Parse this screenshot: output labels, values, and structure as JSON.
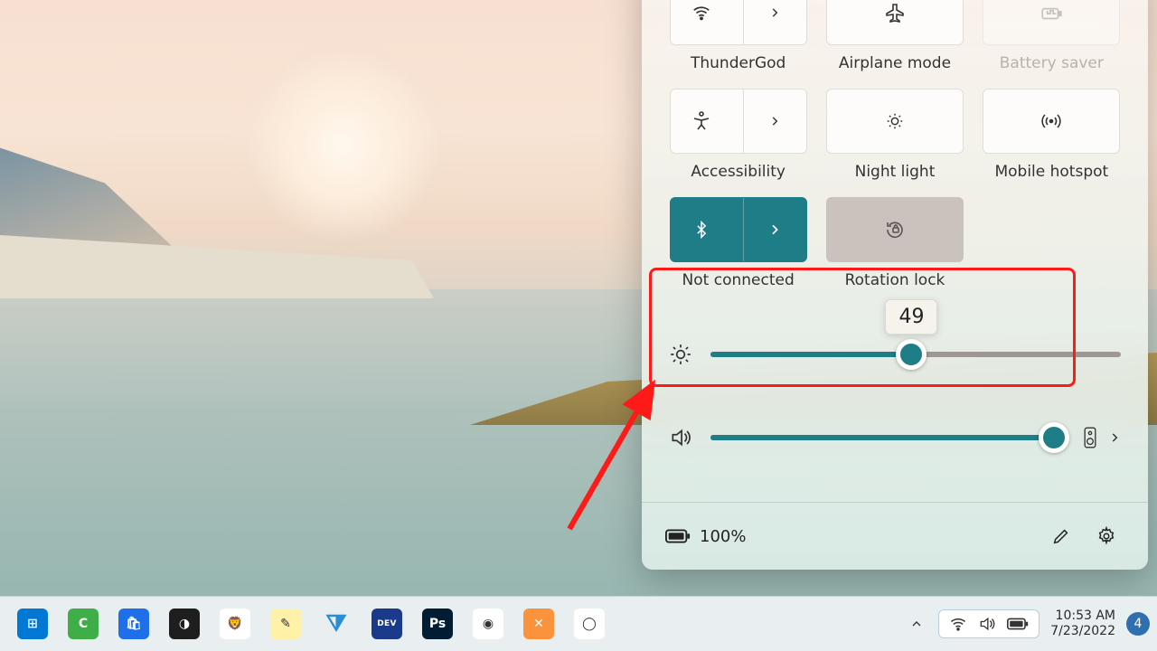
{
  "colors": {
    "accent": "#1f7d87",
    "highlight": "#ff1a1a"
  },
  "panel": {
    "row1": [
      {
        "label": "ThunderGod",
        "icon": "wifi",
        "chevron": true,
        "state": "off",
        "faded": false
      },
      {
        "label": "Airplane mode",
        "icon": "airplane",
        "chevron": false,
        "state": "off",
        "faded": false
      },
      {
        "label": "Battery saver",
        "icon": "battery-saver",
        "chevron": false,
        "state": "off",
        "faded": true
      }
    ],
    "row2": [
      {
        "label": "Accessibility",
        "icon": "accessibility",
        "chevron": true,
        "state": "off"
      },
      {
        "label": "Night light",
        "icon": "night-light",
        "chevron": false,
        "state": "off"
      },
      {
        "label": "Mobile hotspot",
        "icon": "hotspot",
        "chevron": false,
        "state": "off"
      }
    ],
    "row3": [
      {
        "label": "Not connected",
        "icon": "bluetooth",
        "chevron": true,
        "state": "on"
      },
      {
        "label": "Rotation lock",
        "icon": "rotation-lock",
        "chevron": false,
        "state": "dim"
      }
    ],
    "brightness": {
      "value": 49,
      "tooltip": "49"
    },
    "volume": {
      "value": 97
    },
    "footer": {
      "battery_text": "100%"
    }
  },
  "taskbar": {
    "apps": [
      {
        "name": "start",
        "bg": "#0078d4",
        "glyph": "⊞"
      },
      {
        "name": "camtasia",
        "bg": "#3fae49",
        "glyph": "C"
      },
      {
        "name": "ms-store",
        "bg": "#1f6feb",
        "glyph": "🛍"
      },
      {
        "name": "figma",
        "bg": "#1e1e1e",
        "glyph": "◑"
      },
      {
        "name": "brave",
        "bg": "#ffffff",
        "glyph": "🦁"
      },
      {
        "name": "notepadpp",
        "bg": "#fff1a8",
        "glyph": "✎"
      },
      {
        "name": "vscode",
        "bg": "#e9eef1",
        "glyph": "⧩"
      },
      {
        "name": "devcpp",
        "bg": "#1b3a8a",
        "glyph": "DEV"
      },
      {
        "name": "photoshop",
        "bg": "#001d34",
        "glyph": "Ps"
      },
      {
        "name": "chrome",
        "bg": "#ffffff",
        "glyph": "◉"
      },
      {
        "name": "xampp",
        "bg": "#fb923c",
        "glyph": "✕"
      },
      {
        "name": "cortana",
        "bg": "#ffffff",
        "glyph": "◯"
      }
    ],
    "tray": {
      "time": "10:53 AM",
      "date": "7/23/2022",
      "notif_count": "4"
    }
  }
}
